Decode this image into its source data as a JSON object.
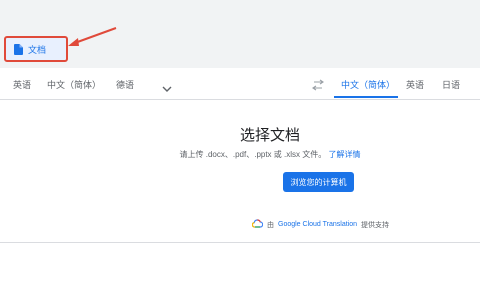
{
  "tabs": {
    "documents_label": "文档"
  },
  "source_langs": [
    "英语",
    "中文（简体）",
    "德语"
  ],
  "target_langs": [
    "中文（简体）",
    "英语",
    "日语"
  ],
  "main": {
    "title": "选择文档",
    "hint": "请上传 .docx、.pdf、.pptx 或 .xlsx 文件。",
    "learn_more": "了解详情",
    "browse_button": "浏览您的计算机",
    "powered_prefix": "由",
    "powered_brand": "Google Cloud Translation",
    "powered_suffix": "提供支持"
  },
  "colors": {
    "accent": "#1a73e8",
    "highlight": "#e04a3a"
  }
}
